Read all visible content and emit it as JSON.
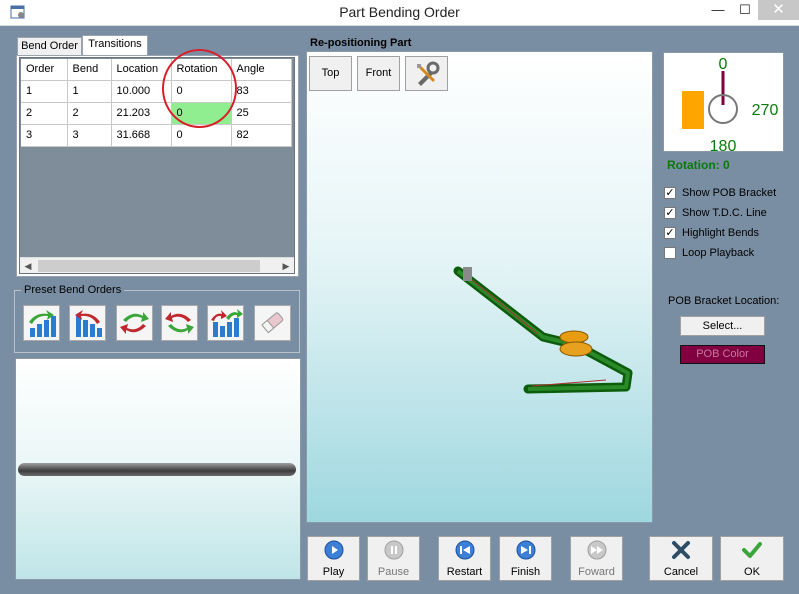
{
  "window": {
    "title": "Part Bending Order",
    "min_glyph": "—",
    "max_glyph": "☐",
    "close_glyph": "✕"
  },
  "tabs": [
    {
      "label": "Bend Order"
    },
    {
      "label": "Transitions"
    }
  ],
  "grid": {
    "columns": [
      "Order",
      "Bend",
      "Location",
      "Rotation",
      "Angle"
    ],
    "rows": [
      [
        "1",
        "1",
        "10.000",
        "0",
        "83"
      ],
      [
        "2",
        "2",
        "21.203",
        "0",
        "25"
      ],
      [
        "3",
        "3",
        "31.668",
        "0",
        "82"
      ]
    ],
    "selected_cell": {
      "row": 1,
      "col": 3
    }
  },
  "preset": {
    "label": "Preset Bend Orders"
  },
  "view": {
    "title": "Re-positioning Part",
    "top_label": "Top",
    "front_label": "Front"
  },
  "rotation": {
    "marks": {
      "top": "0",
      "right": "270",
      "bottom": "180"
    },
    "label": "Rotation: 0"
  },
  "options": [
    {
      "label": "Show POB Bracket",
      "checked": true
    },
    {
      "label": "Show T.D.C. Line",
      "checked": true
    },
    {
      "label": "Highlight Bends",
      "checked": true
    },
    {
      "label": "Loop Playback",
      "checked": false
    }
  ],
  "pob": {
    "location_label": "POB Bracket Location:",
    "select_label": "Select...",
    "color_label": "POB Color",
    "color": "#800040"
  },
  "playback": [
    {
      "label": "Play",
      "icon": "play-icon",
      "enabled": true
    },
    {
      "label": "Pause",
      "icon": "pause-icon",
      "enabled": false
    },
    {
      "label": "Restart",
      "icon": "restart-icon",
      "enabled": true
    },
    {
      "label": "Finish",
      "icon": "finish-icon",
      "enabled": true
    },
    {
      "label": "Foward",
      "icon": "forward-icon",
      "enabled": false
    }
  ],
  "dialog": {
    "cancel_label": "Cancel",
    "ok_label": "OK"
  },
  "colors": {
    "accent_green": "#0a7a0a",
    "highlight": "#90ee90",
    "annotation_red": "#d91f2a"
  }
}
